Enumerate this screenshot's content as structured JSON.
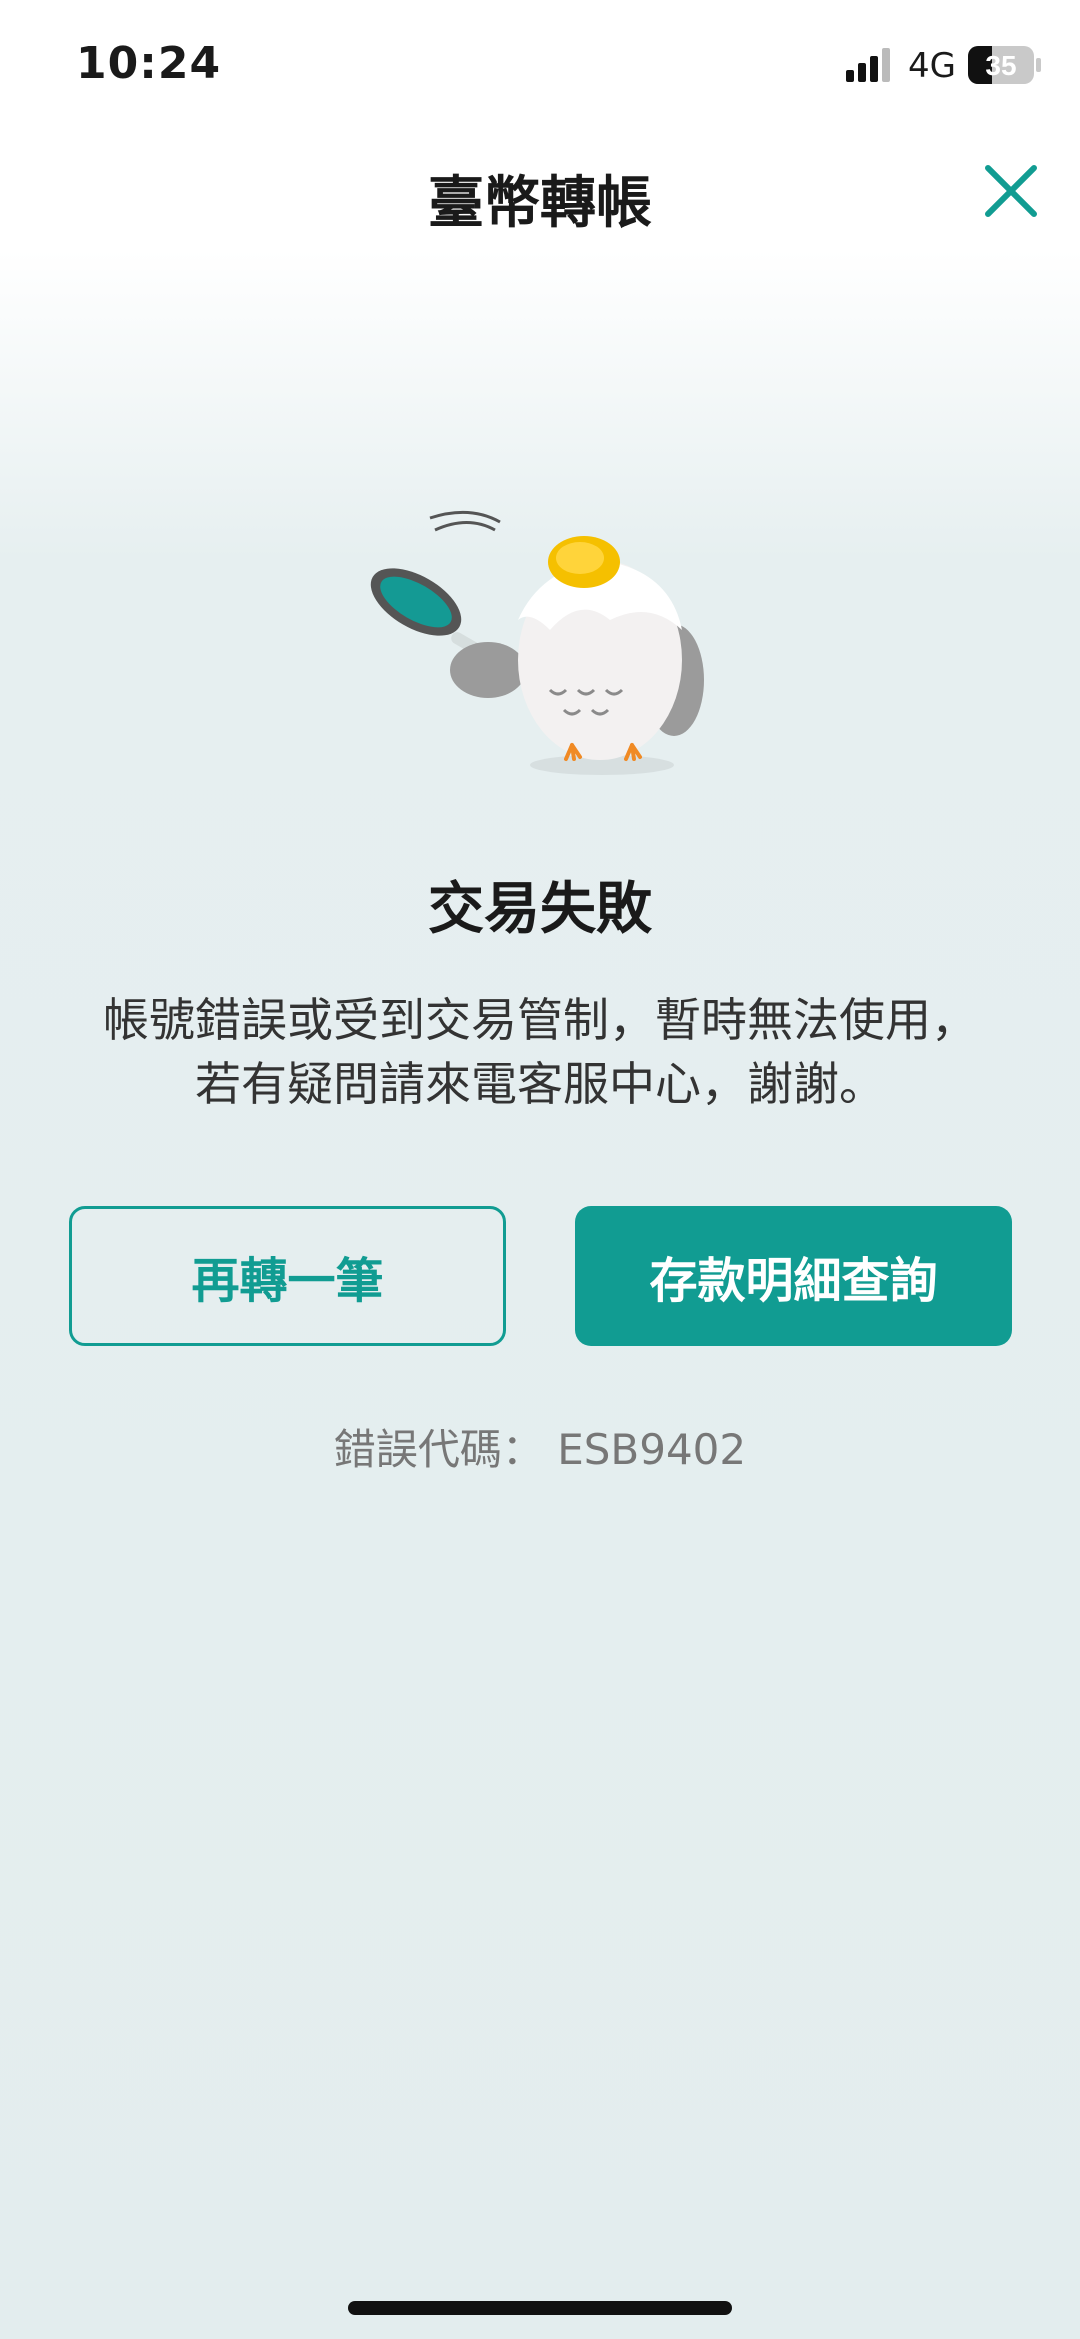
{
  "status_bar": {
    "time": "10:24",
    "network": "4G",
    "battery": "35"
  },
  "header": {
    "title": "臺幣轉帳",
    "close_icon": "close-icon"
  },
  "mascot": {
    "icon": "owl-frying-pan-illustration"
  },
  "result": {
    "title": "交易失敗",
    "message_line1": "帳號錯誤或受到交易管制，暫時無法使用，",
    "message_line2": "若有疑問請來電客服中心，謝謝。"
  },
  "actions": {
    "retry_label": "再轉一筆",
    "details_label": "存款明細查詢"
  },
  "error": {
    "label": "錯誤代碼： ESB9402"
  },
  "colors": {
    "accent": "#119c92",
    "background": "#e3edee"
  }
}
